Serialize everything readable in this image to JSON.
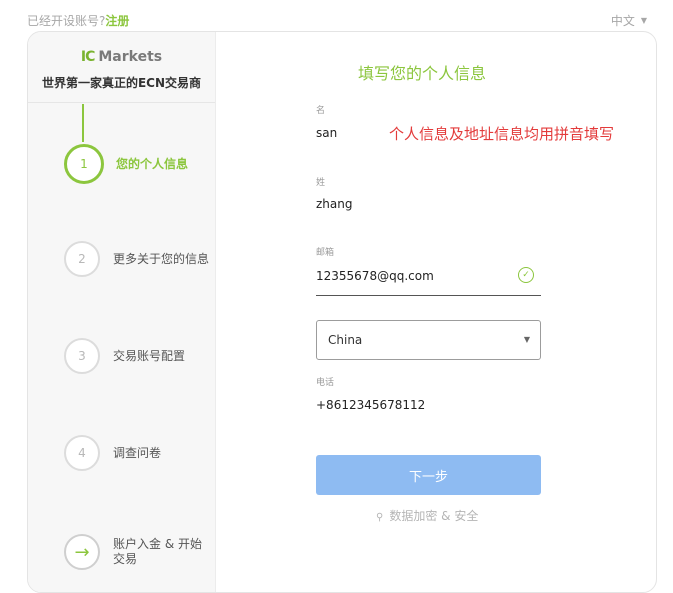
{
  "topbar": {
    "already_text": "已经开设账号?",
    "register_link": "注册",
    "language": "中文"
  },
  "brand": {
    "logo_mark": "IC",
    "logo_name": "Markets",
    "tagline": "世界第一家真正的ECN交易商"
  },
  "steps": [
    {
      "num": "1",
      "label": "您的个人信息"
    },
    {
      "num": "2",
      "label": "更多关于您的信息"
    },
    {
      "num": "3",
      "label": "交易账号配置"
    },
    {
      "num": "4",
      "label": "调查问卷"
    },
    {
      "num": "→",
      "label": "账户入金 & 开始交易"
    }
  ],
  "form": {
    "title": "填写您的个人信息",
    "note": "个人信息及地址信息均用拼音填写",
    "first_name_label": "名",
    "first_name_value": "san",
    "last_name_label": "姓",
    "last_name_value": "zhang",
    "email_label": "邮箱",
    "email_value": "12355678@qq.com",
    "country_value": "China",
    "phone_label": "电话",
    "phone_value": "+8612345678112",
    "next_label": "下一步",
    "secure_text": "数据加密 & 安全"
  },
  "colors": {
    "accent_green": "#8cc63e",
    "button_blue": "#8ebbf2",
    "note_red": "#e33b3b"
  }
}
